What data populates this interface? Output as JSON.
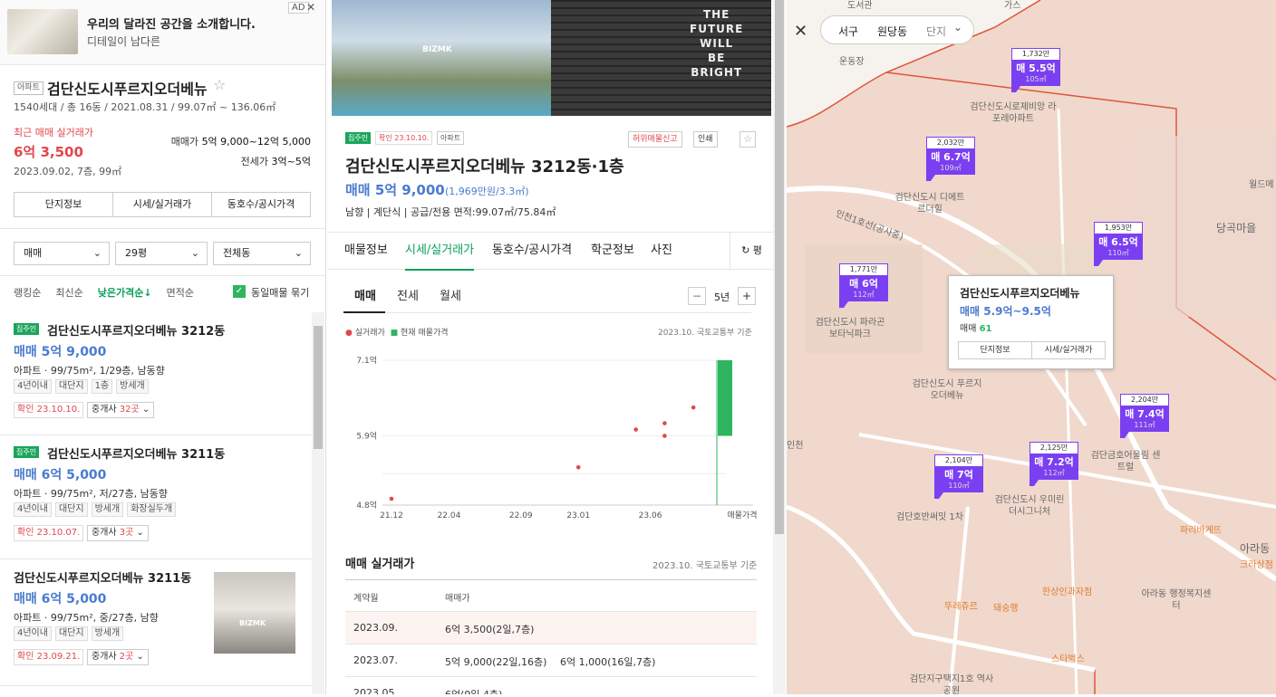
{
  "ad": {
    "title": "우리의 달라진 공간을 소개합니다.",
    "subtitle": "디테일이 남다른",
    "badge": "AD",
    "close": "✕"
  },
  "complex": {
    "type_tag": "아파트",
    "name": "검단신도시푸르지오더베뉴",
    "star": "☆",
    "info": "1540세대 / 총 16동 / 2021.08.31 / 99.07㎡ ~ 136.06㎡",
    "recent_label": "최근 매매 실거래가",
    "recent_price": "6억 3,500",
    "recent_date": "2023.09.02, 7층, 99㎡",
    "sale_label": "매매가",
    "sale_value": "5억 9,000~12억 5,000",
    "jeonse_label": "전세가",
    "jeonse_value": "3억~5억",
    "tabs": [
      "단지정보",
      "시세/실거래가",
      "동호수/공시가격"
    ]
  },
  "filters": {
    "deal": "매매",
    "size": "29평",
    "dong": "전체동",
    "chevron": "⌄"
  },
  "sort": {
    "options": [
      "랭킹순",
      "최신순",
      "낮은가격순↓",
      "면적순"
    ],
    "group_check": "✓",
    "group_label": "동일매물 묶기"
  },
  "listings": [
    {
      "owner": "집주인",
      "name": "검단신도시푸르지오더베뉴 3212동",
      "price": "매매 5억 9,000",
      "desc": "아파트 · 99/75m², 1/29층, 남동향",
      "chips": [
        "4년이내",
        "대단지",
        "1층",
        "방세개"
      ],
      "confirm": "확인 23.10.10.",
      "agent_pre": "중개사 ",
      "agent_count": "32곳",
      "agent_post": " ⌄"
    },
    {
      "owner": "집주인",
      "name": "검단신도시푸르지오더베뉴 3211동",
      "price": "매매 6억 5,000",
      "desc": "아파트 · 99/75m², 저/27층, 남동향",
      "chips": [
        "4년이내",
        "대단지",
        "방세개",
        "화장실두개"
      ],
      "confirm": "확인 23.10.07.",
      "agent_pre": "중개사 ",
      "agent_count": "3곳",
      "agent_post": " ⌄"
    },
    {
      "owner": "",
      "name": "검단신도시푸르지오더베뉴 3211동",
      "price": "매매 6억 5,000",
      "desc": "아파트 · 99/75m², 중/27층, 남향",
      "chips": [
        "4년이내",
        "대단지",
        "방세개"
      ],
      "confirm": "확인 23.09.21.",
      "agent_pre": "중개사 ",
      "agent_count": "2곳",
      "agent_post": " ⌄",
      "thumb_logo": "BIZMK"
    }
  ],
  "detail": {
    "photo_text": [
      "THE",
      "FUTURE",
      "WILL",
      "BE",
      "BRIGHT"
    ],
    "photo_logo": "BIZMK",
    "owner": "집주인",
    "confirm": "확인 23.10.10.",
    "type_tag": "아파트",
    "report": "허위매물신고",
    "print": "인쇄",
    "star": "☆",
    "title": "검단신도시푸르지오더베뉴 3212동·1층",
    "price": "매매 5억 9,000",
    "price_sub": "(1,969만원/3.3㎡)",
    "meta": "남향 | 계단식 | 공급/전용 면적:99.07㎡/75.84㎡",
    "tabs": [
      "매물정보",
      "시세/실거래가",
      "동호수/공시가격",
      "학군정보",
      "사진"
    ],
    "tab_right": "↻ 평",
    "subtabs": [
      "매매",
      "전세",
      "월세"
    ],
    "stepper_minus": "−",
    "stepper_value": "5년",
    "stepper_plus": "+",
    "legend_real": "실거래가",
    "legend_current": "현재 매물가격",
    "chart_source": "2023.10. 국토교통부 기준",
    "section_title": "매매 실거래가",
    "section_source": "2023.10. 국토교통부 기준",
    "table_headers": [
      "계약월",
      "매매가"
    ],
    "table_rows": [
      {
        "month": "2023.09.",
        "price1": "6억 3,500(2일,7층)",
        "price2": ""
      },
      {
        "month": "2023.07.",
        "price1": "5억 9,000(22일,16층)",
        "price2": "6억 1,000(16일,7층)"
      },
      {
        "month": "2023.05.",
        "price1": "6억(9일,4층)",
        "price2": ""
      }
    ]
  },
  "chart_data": {
    "type": "scatter",
    "xlabel": "",
    "ylabel": "",
    "x_ticks": [
      "21.12",
      "22.04",
      "22.09",
      "23.01",
      "23.06",
      "매물가격"
    ],
    "y_ticks": [
      "7.1억",
      "5.9억",
      "4.8억"
    ],
    "ylim": [
      4.8,
      7.1
    ],
    "series": [
      {
        "name": "실거래가",
        "color": "#e0474c",
        "points": [
          {
            "x": "2021.12",
            "y": 4.9
          },
          {
            "x": "2023.01",
            "y": 5.4
          },
          {
            "x": "2023.05",
            "y": 6.0
          },
          {
            "x": "2023.07",
            "y": 5.9
          },
          {
            "x": "2023.07",
            "y": 6.1
          },
          {
            "x": "2023.09",
            "y": 6.35
          }
        ]
      },
      {
        "name": "현재 매물가격",
        "color": "#2fb55f",
        "range": [
          5.9,
          7.1
        ]
      }
    ]
  },
  "map": {
    "close": "✕",
    "crumbs": [
      "서구",
      "원당동",
      "단지"
    ],
    "chev": "⌄",
    "markers": [
      {
        "top": "1,732만",
        "price": "매 5.5억",
        "area": "105㎡"
      },
      {
        "top": "2,032만",
        "price": "매 6.7억",
        "area": "109㎡"
      },
      {
        "top": "1,953만",
        "price": "매 6.5억",
        "area": "110㎡"
      },
      {
        "top": "1,771만",
        "price": "매 6억",
        "area": "112㎡"
      },
      {
        "top": "2,204만",
        "price": "매 7.4억",
        "area": "111㎡"
      },
      {
        "top": "2,125만",
        "price": "매 7.2억",
        "area": "112㎡"
      },
      {
        "top": "2,104만",
        "price": "매 7억",
        "area": "110㎡"
      }
    ],
    "labels": [
      "검단신도시로제비앙 라포레아파트",
      "검단신도시 디에트르더힐",
      "검단신도시 파라곤보타닉파크",
      "검단신도시 푸르지오더베뉴",
      "검단금호어울림 센트럴",
      "검단신도시 우미린더시그니처",
      "검단호반써밋 1차",
      "당곡마을",
      "운동장",
      "도서관",
      "아라동 행정복지센터",
      "검단지구택지1호 역사공원",
      "인천1호선(공사중)",
      "아라동",
      "월드메",
      "파리바게뜨",
      "크라상점",
      "한상인과자점",
      "뚜레쥬르",
      "돼숭행",
      "스타벅스",
      "가스",
      "인천"
    ],
    "popup": {
      "name": "검단신도시푸르지오더베뉴",
      "price": "매매 5.9억~9.5억",
      "count_label": "매매 ",
      "count": "61",
      "btn1": "단지정보",
      "btn2": "시세/실거래가"
    }
  }
}
